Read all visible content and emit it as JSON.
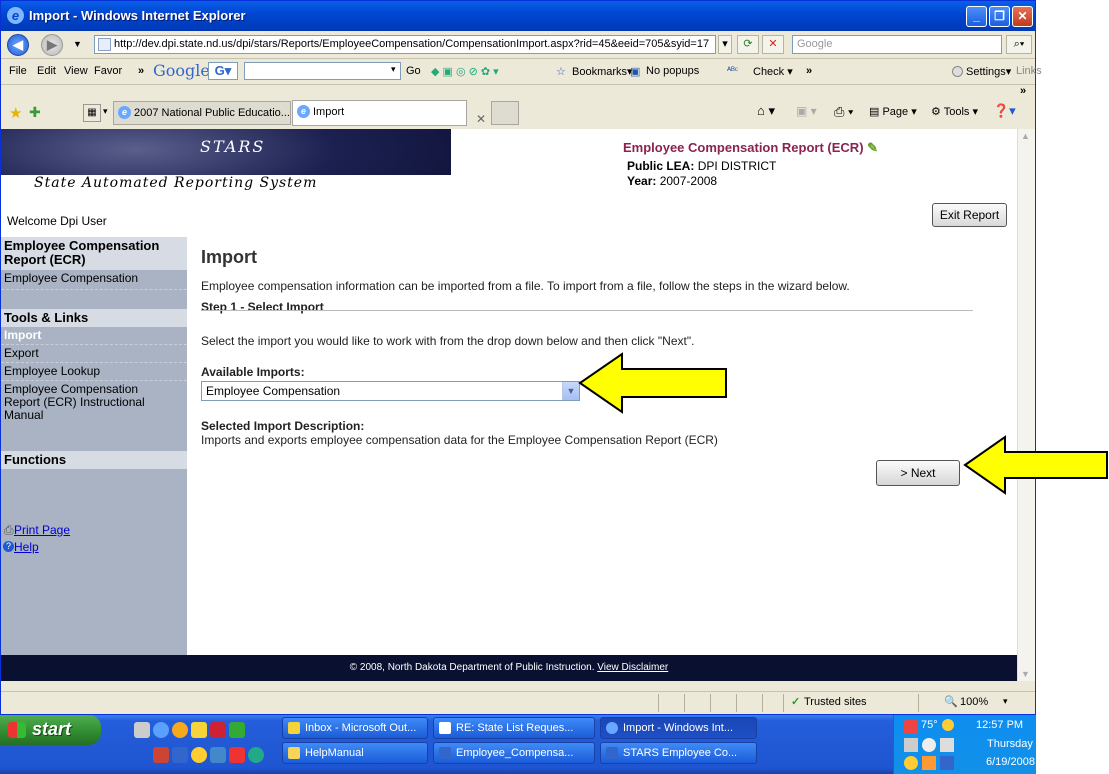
{
  "window": {
    "title": "Import - Windows Internet Explorer",
    "minimize": "_",
    "maximize": "❐",
    "close": "✕"
  },
  "address": {
    "url": "http://dev.dpi.state.nd.us/dpi/stars/Reports/EmployeeCompensation/CompensationImport.aspx?rid=45&eeid=705&syid=17",
    "search_placeholder": "Google"
  },
  "google_bar": {
    "file": "File",
    "edit": "Edit",
    "view": "View",
    "favor": "Favor",
    "chevron": "»",
    "google": "Google",
    "go": "Go",
    "bookmarks": "Bookmarks▾",
    "no_popups": "No popups",
    "check": "Check ▾",
    "settings": "Settings▾",
    "links": "Links"
  },
  "tabs": [
    {
      "label": "2007 National Public Educatio..."
    },
    {
      "label": "Import"
    }
  ],
  "toolbar_right": {
    "page": "Page ▾",
    "tools": "Tools ▾"
  },
  "header": {
    "stars_logo": "STARS",
    "subtitle": "State Automated Reporting System",
    "welcome": "Welcome Dpi User",
    "report_title": "Employee Compensation Report (ECR)",
    "lea_label": "Public LEA:",
    "lea_value": "DPI DISTRICT",
    "year_label": "Year:",
    "year_value": "2007-2008",
    "exit_button": "Exit Report"
  },
  "sidebar": {
    "section1_title": "Employee Compensation Report (ECR)",
    "section1_items": [
      "Employee Compensation"
    ],
    "section2_title": "Tools & Links",
    "section2_items": [
      "Import",
      "Export",
      "Employee Lookup",
      "Employee Compensation Report (ECR) Instructional Manual"
    ],
    "section3_title": "Functions",
    "print_page": "Print Page",
    "help": "Help"
  },
  "main": {
    "heading": "Import",
    "intro": "Employee compensation information can be imported from a file. To import from a file, follow the steps in the wizard below.",
    "step": "Step 1 - Select Import",
    "instruction": "Select the import you would like to work with from the drop down below and then click \"Next\".",
    "available_label": "Available Imports:",
    "selected_value": "Employee Compensation",
    "desc_label": "Selected Import Description:",
    "desc_text": "Imports and exports employee compensation data for the Employee Compensation Report (ECR)",
    "next_button": "> Next"
  },
  "footer": {
    "text": "© 2008, North Dakota Department of Public Instruction.",
    "link": "View Disclaimer"
  },
  "status": {
    "zone": "Trusted sites",
    "zoom": "100%"
  },
  "taskbar": {
    "start": "start",
    "buttons": [
      "Inbox - Microsoft Out...",
      "RE: State List Reques...",
      "Import - Windows Int...",
      "HelpManual",
      "Employee_Compensa...",
      "STARS Employee Co..."
    ],
    "temp": "75°",
    "time": "12:57 PM",
    "day": "Thursday",
    "date": "6/19/2008"
  },
  "colors": {
    "accent_title": "#8b2252",
    "sidebar_bg": "#a9b3c3",
    "arrow": "#ffff00"
  }
}
